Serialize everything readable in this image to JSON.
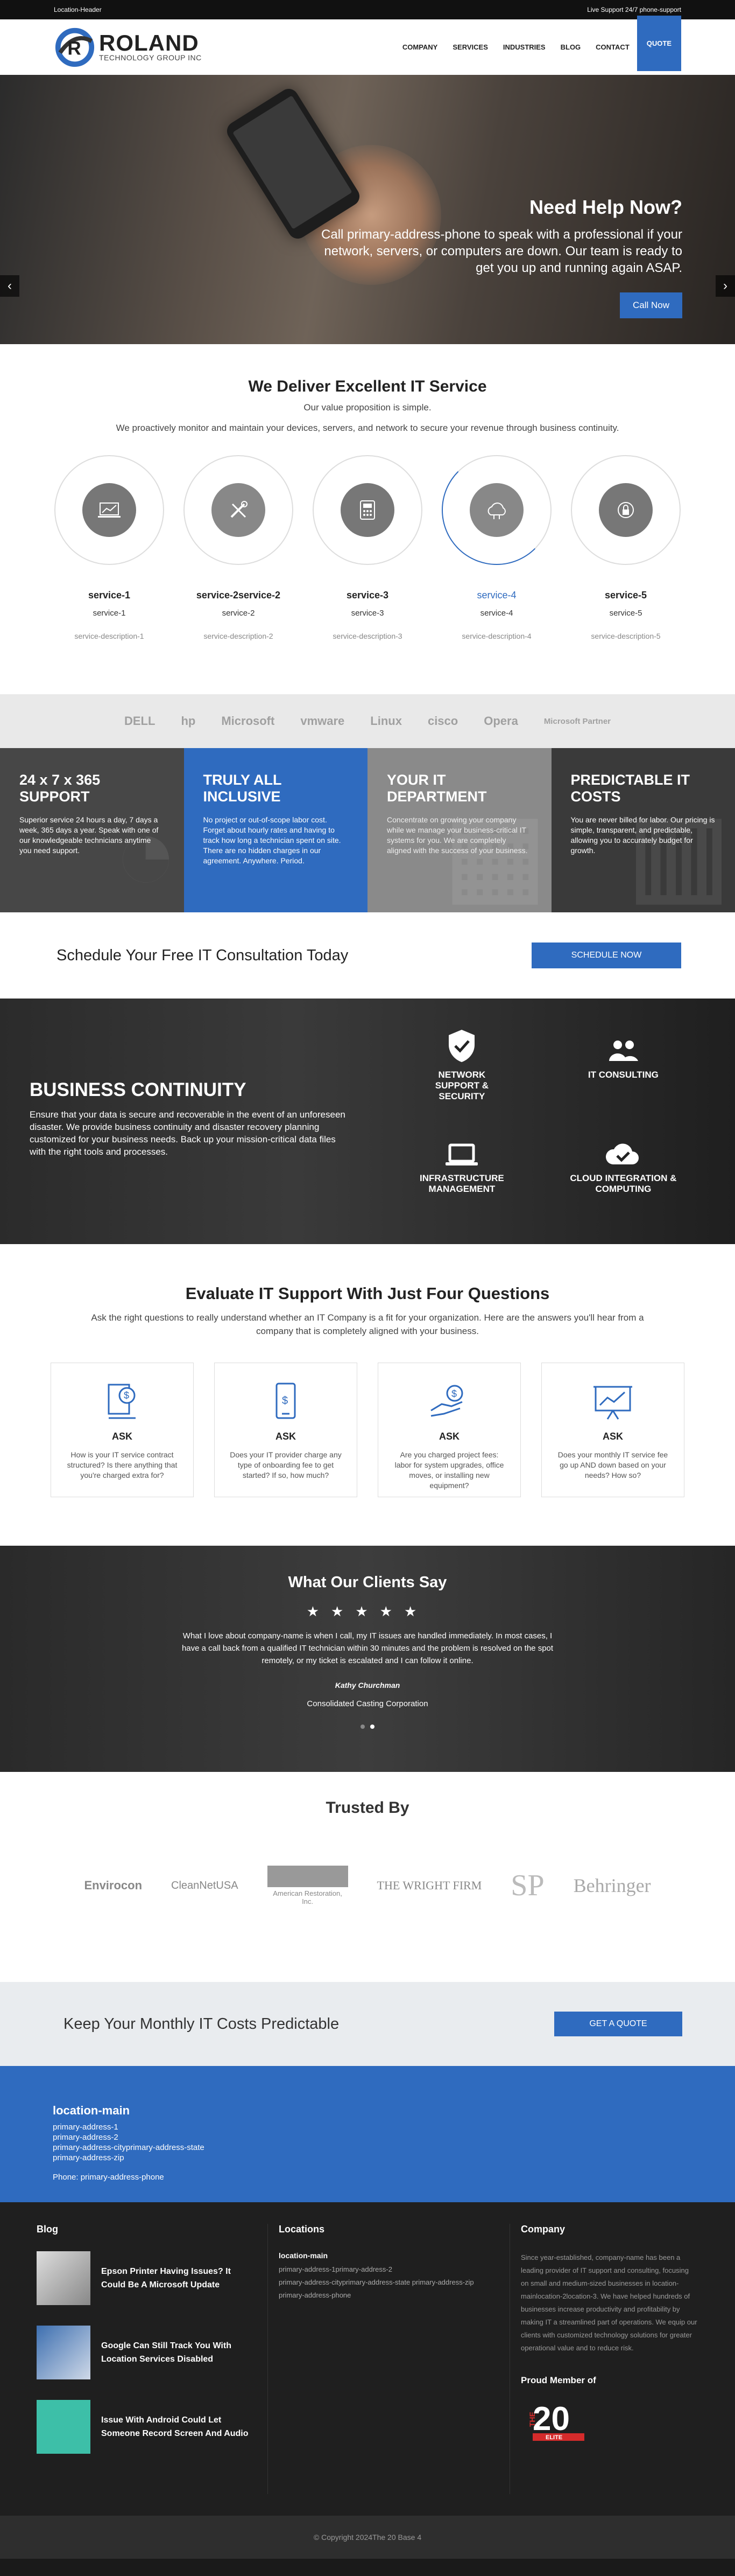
{
  "topbar": {
    "left": "Location-Header",
    "right": "Live Support 24/7 phone-support"
  },
  "logo": {
    "name": "ROLAND",
    "tagline": "TECHNOLOGY GROUP INC"
  },
  "nav": [
    "COMPANY",
    "SERVICES",
    "INDUSTRIES",
    "BLOG",
    "CONTACT",
    "QUOTE"
  ],
  "hero": {
    "title": "Need Help Now?",
    "text": "Call primary-address-phone to speak with a professional if your network, servers, or computers are down. Our team is ready to get you up and running again ASAP.",
    "button": "Call Now",
    "prev": "‹",
    "next": "›"
  },
  "services": {
    "title": "We Deliver Excellent IT Service",
    "subtitle": "Our value proposition is simple.",
    "subtitle2": "We proactively monitor and maintain your devices, servers, and network to secure your revenue through business continuity.",
    "items": [
      {
        "name": "service-1",
        "name2": "service-1",
        "desc": "service-description-1",
        "icon": "laptop-chart-icon"
      },
      {
        "name": "service-2service-2",
        "name2": "service-2",
        "desc": "service-description-2",
        "icon": "tools-icon"
      },
      {
        "name": "service-3",
        "name2": "service-3",
        "desc": "service-description-3",
        "icon": "phone-system-icon"
      },
      {
        "name": "service-4",
        "name2": "service-4",
        "desc": "service-description-4",
        "icon": "cloud-icon"
      },
      {
        "name": "service-5",
        "name2": "service-5",
        "desc": "service-description-5",
        "icon": "network-lock-icon"
      }
    ]
  },
  "partners": [
    "DELL",
    "hp",
    "Microsoft",
    "vmware",
    "Linux",
    "cisco",
    "Opera",
    "Microsoft Partner"
  ],
  "features": [
    {
      "title": "24 x 7 x 365 SUPPORT",
      "text": "Superior service 24 hours a day, 7 days a week, 365 days a year. Speak with one of our knowledgeable technicians anytime you need support."
    },
    {
      "title": "TRULY ALL INCLUSIVE",
      "text": "No project or out-of-scope labor cost. Forget about hourly rates and having to track how long a technician spent on site. There are no hidden charges in our agreement. Anywhere. Period."
    },
    {
      "title": "YOUR IT DEPARTMENT",
      "text": "Concentrate on growing your company while we manage your business-critical IT systems for you. We are completely aligned with the success of your business."
    },
    {
      "title": "PREDICTABLE IT COSTS",
      "text": "You are never billed for labor. Our pricing is simple, transparent, and predictable, allowing you to accurately budget for growth."
    }
  ],
  "consult": {
    "title": "Schedule Your Free IT Consultation Today",
    "button": "SCHEDULE NOW"
  },
  "continuity": {
    "title": "BUSINESS CONTINUITY",
    "text": "Ensure that your data is secure and recoverable in the event of an unforeseen disaster. We provide business continuity and disaster recovery planning customized for your business needs. Back up your mission-critical data files with the right tools and processes.",
    "items": [
      "NETWORK SUPPORT & SECURITY",
      "IT CONSULTING",
      "INFRASTRUCTURE MANAGEMENT",
      "CLOUD INTEGRATION & COMPUTING"
    ]
  },
  "evaluate": {
    "title": "Evaluate IT Support With Just Four Questions",
    "subtitle": "Ask the right questions to really understand whether an IT Company is a fit for your organization. Here are the answers you'll hear from a company that is completely aligned with your business.",
    "cards": [
      {
        "title": "ASK",
        "text": "How is your IT service contract structured? Is there anything that you're charged extra for?"
      },
      {
        "title": "ASK",
        "text": "Does your IT provider charge any type of onboarding fee to get started? If so, how much?"
      },
      {
        "title": "ASK",
        "text": "Are you charged project fees: labor for system upgrades, office moves, or installing new equipment?"
      },
      {
        "title": "ASK",
        "text": "Does your monthly IT service fee go up AND down based on your needs? How so?"
      }
    ]
  },
  "testimonial": {
    "title": "What Our Clients Say",
    "stars": "★★★★★",
    "quote": "What I love about company-name is when I call, my IT issues are handled immediately. In most cases, I have a call back from a qualified IT technician within 30 minutes and the problem is resolved on the spot remotely, or my ticket is escalated and I can follow it online.",
    "author": "Kathy Churchman",
    "company": "Consolidated Casting Corporation"
  },
  "trusted": {
    "title": "Trusted By",
    "logos": [
      "Envirocon",
      "CleanNetUSA",
      "American Restoration, Inc.",
      "THE WRIGHT FIRM",
      "SP",
      "Behringer"
    ]
  },
  "cta": {
    "title": "Keep Your Monthly IT Costs Predictable",
    "button": "GET A QUOTE"
  },
  "location": {
    "name": "location-main",
    "lines": [
      "primary-address-1",
      "primary-address-2",
      "primary-address-cityprimary-address-state",
      "primary-address-zip"
    ],
    "phone": "Phone: primary-address-phone"
  },
  "footer": {
    "blog_title": "Blog",
    "posts": [
      "Epson Printer Having Issues? It Could Be A Microsoft Update",
      "Google Can Still Track You With Location Services Disabled",
      "Issue With Android Could Let Someone Record Screen And Audio"
    ],
    "locations_title": "Locations",
    "loc_name": "location-main",
    "loc_lines": [
      "primary-address-1primary-address-2",
      "primary-address-cityprimary-address-state primary-address-zip",
      "primary-address-phone"
    ],
    "company_title": "Company",
    "company_text": "Since year-established, company-name has been a leading provider of IT support and consulting, focusing on small and medium-sized businesses in location-mainlocation-2location-3. We have helped hundreds of businesses increase productivity and profitability by making IT a streamlined part of operations. We equip our clients with customized technology solutions for greater operational value and to reduce risk.",
    "member": "Proud Member of",
    "badge": "THE 20 ELITE"
  },
  "copyright": "© Copyright 2024The 20 Base 4"
}
